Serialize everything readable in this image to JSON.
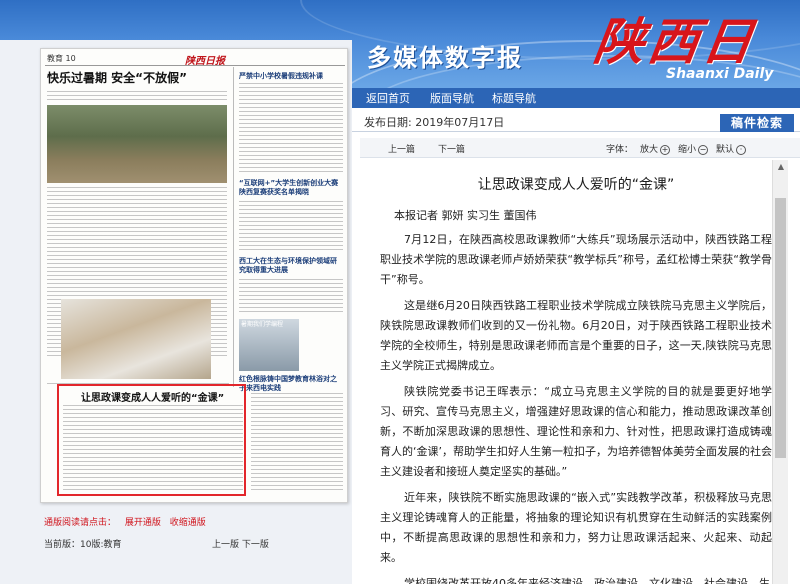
{
  "header": {
    "subtitle": "多媒体数字报",
    "logo_text": "陕西日报",
    "logo_en": "Shaanxi Daily"
  },
  "nav": {
    "items": [
      "返回首页",
      "版面导航",
      "标题导航"
    ]
  },
  "date_bar": {
    "label": "发布日期: 2019年07月17日",
    "search_label": "稿件检索"
  },
  "toolbar": {
    "prev": "上一篇",
    "next": "下一篇",
    "font_label": "字体：",
    "zoom_in": "放大",
    "zoom_out": "缩小",
    "default": "默认"
  },
  "newspaper": {
    "edition_label": "教育 10",
    "logo": "陕西日报",
    "headline": "快乐过暑期  安全“不放假”",
    "side_head_1": "严禁中小学校暑假违规补课",
    "side_head_2": "“互联网+”大学生创新创业大赛陕西复赛获奖名单揭晓",
    "side_head_3": "西工大在生态与环境保护领域研究取得重大进展",
    "side_head_4": "红色根脉铸中国梦教育林浴对之子来西电实践",
    "photo_caption": "暑期我们学编程",
    "highlight_headline": "让思政课变成人人爱听的“金课”"
  },
  "bottom": {
    "links_label": "通版阅读请点击：",
    "open_link": "展开通版",
    "close_link": "收缩通版",
    "current": "当前版：10版:教育",
    "prev_page": "上一版",
    "next_page": "下一版"
  },
  "article": {
    "title": "让思政课变成人人爱听的“金课”",
    "byline": "本报记者  郭妍  实习生  董国伟",
    "paragraphs": [
      "7月12日，在陕西高校思政课教师“大练兵”现场展示活动中，陕西铁路工程职业技术学院的思政课老师卢娇娇荣获“教学标兵”称号，孟红松博士荣获“教学骨干”称号。",
      "这是继6月20日陕西铁路工程职业技术学院成立陕铁院马克思主义学院后，陕铁院思政课教师们收到的又一份礼物。6月20日，对于陕西铁路工程职业技术学院的全校师生，特别是思政课老师而言是个重要的日子，这一天,陕铁院马克思主义学院正式揭牌成立。",
      "陕铁院党委书记王晖表示：“成立马克思主义学院的目的就是要更好地学习、研究、宣传马克思主义，增强建好思政课的信心和能力，推动思政课改革创新，不断加深思政课的思想性、理论性和亲和力、针对性，把思政课打造成铸魂育人的‘金课’，帮助学生扣好人生第一粒扣子，为培养德智体美劳全面发展的社会主义建设者和接班人奠定坚实的基础。”",
      "近年来，陕铁院不断实施思政课的“嵌入式”实践教学改革，积极释放马克思主义理论铸魂育人的正能量，将抽象的理论知识有机贯穿在生动鲜活的实践案例中，不断提高思政课的思想性和亲和力，努力让思政课活起来、火起来、动起来。",
      "学校围绕改革开放40多年来经济建设、政治建设、文化建设、社会建设、生"
    ]
  }
}
